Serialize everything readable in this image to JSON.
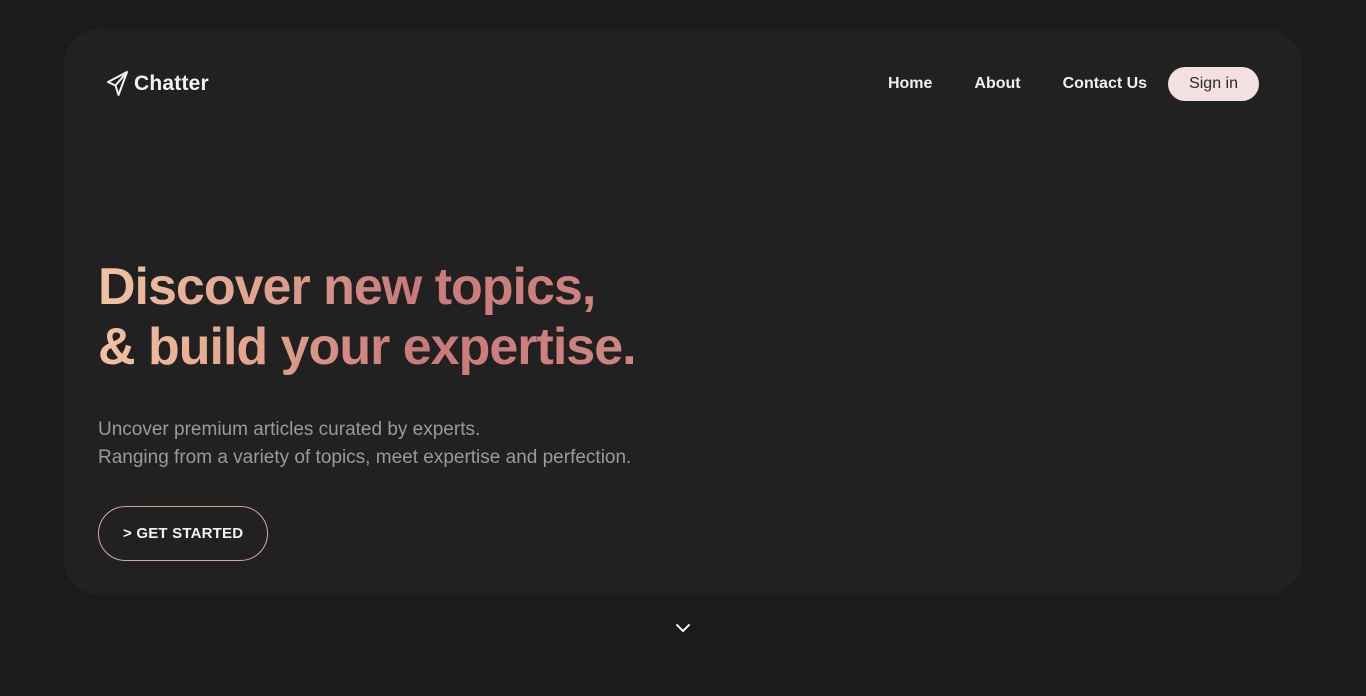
{
  "brand": {
    "name": "Chatter",
    "icon": "paper-plane-icon"
  },
  "nav": {
    "items": [
      {
        "label": "Home"
      },
      {
        "label": "About"
      },
      {
        "label": "Contact Us"
      }
    ],
    "signin_label": "Sign in"
  },
  "hero": {
    "headline_line1": "Discover new topics,",
    "headline_line2": "& build your expertise.",
    "subtext_line1": "Uncover premium articles curated by experts.",
    "subtext_line2": "Ranging from a variety of topics, meet expertise and perfection.",
    "cta_label": "> GET STARTED"
  },
  "scroll_icon": "chevron-down-icon",
  "colors": {
    "background": "#1b1b1b",
    "card": "#212121",
    "gradient_start": "#f1c2a2",
    "gradient_end": "#cd7e7e",
    "signin_bg": "#f2e1e0",
    "cta_border": "#d9a995"
  }
}
